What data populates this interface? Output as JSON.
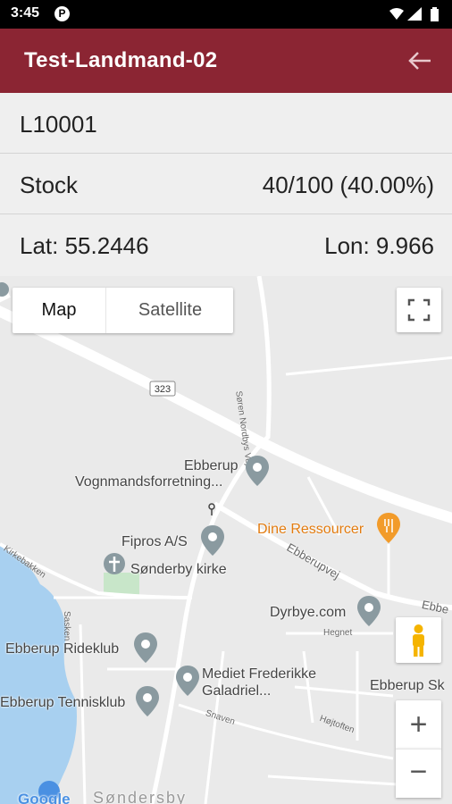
{
  "status_bar": {
    "time": "3:45",
    "badge": "P"
  },
  "app_bar": {
    "title": "Test-Landmand-02"
  },
  "info": {
    "id": "L10001",
    "stock_label": "Stock",
    "stock_value": "40/100 (40.00%)",
    "lat": "Lat: 55.2446",
    "lon": "Lon: 9.966"
  },
  "map": {
    "type_toggle": {
      "map_label": "Map",
      "satellite_label": "Satellite"
    },
    "route_badge": "323",
    "roads": {
      "soren": "Søren Nordbys Vej",
      "ebberupvej": "Ebberupvej",
      "ebbe": "Ebbe",
      "kirkebakken": "Kirkebakken",
      "hegnet": "Hegnet",
      "snaven": "Snaven",
      "hojtoften": "Højtoften",
      "sasken": "Sasken"
    },
    "pois": {
      "ebberup_line1": "Ebberup",
      "ebberup_line2": "Vognmandsforretning...",
      "fipros": "Fipros A/S",
      "kirke": "Sønderby kirke",
      "dine": "Dine Ressourcer",
      "dyrbye": "Dyrbye.com",
      "rideklub": "Ebberup Rideklub",
      "mediet_line1": "Mediet Frederikke",
      "mediet_line2": "Galadriel...",
      "tennis": "Ebberup Tennisklub",
      "ebberup_sk": "Ebberup Sk"
    },
    "town_label": "Søndersby",
    "google_logo": "Google",
    "zoom_in": "+",
    "zoom_out": "−"
  },
  "colors": {
    "app_bar": "#8b2533",
    "status_bar": "#000000",
    "info_bg": "#efefef",
    "map_bg": "#eaeaea",
    "water": "#a8d0f0",
    "park": "#c8e6c9",
    "food_poi": "#e27b0f"
  }
}
